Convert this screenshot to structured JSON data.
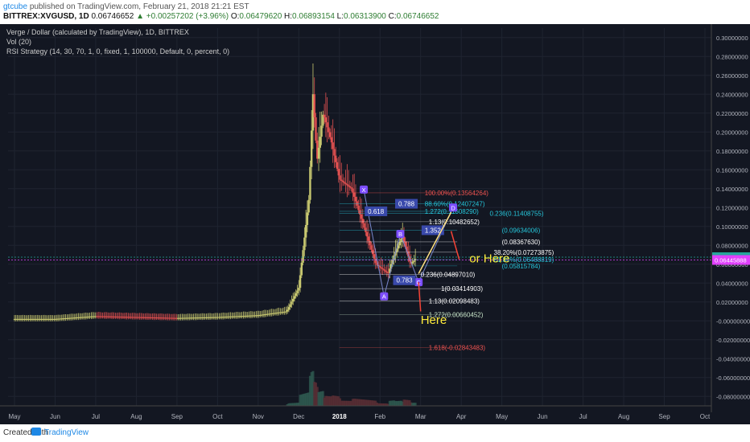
{
  "header": {
    "user": "gtcube",
    "published": "published on TradingView.com, February 21, 2018 21:21 EST",
    "symbol": "BITTREX:XVGUSD, 1D",
    "last": "0.06746652",
    "change": "▲ +0.00257202 (+3.96%)",
    "o_label": "O:",
    "o_val": "0.06479620",
    "h_label": "H:",
    "h_val": "0.06893154",
    "l_label": "L:",
    "l_val": "0.06313900",
    "c_label": "C:",
    "c_val": "0.06746652"
  },
  "legend": {
    "line1": "Verge / Dollar (calculated by TradingView), 1D, BITTREX",
    "line2": "Vol (20)",
    "line3": "RSI Strategy (14, 30, 70, 1, 0, fixed, 1, 100000, Default, 0, percent, 0)"
  },
  "footer": {
    "created": "Created with",
    "brand": "TradingView"
  },
  "colors": {
    "bg": "#131722",
    "up": "#c8c870",
    "down": "#e05050",
    "grid": "#1f2430",
    "axis_text": "#b2b5be"
  },
  "chart_data": {
    "type": "line",
    "title": "Verge / Dollar (calculated by TradingView), 1D, BITTREX",
    "x_ticks": [
      "May",
      "Jun",
      "Jul",
      "Aug",
      "Sep",
      "Oct",
      "Nov",
      "Dec",
      "2018",
      "Feb",
      "Mar",
      "Apr",
      "May",
      "Jun",
      "Jul",
      "Aug",
      "Sep",
      "Oct"
    ],
    "y_ticks": [
      "0.30000000",
      "0.28000000",
      "0.26000000",
      "0.24000000",
      "0.22000000",
      "0.20000000",
      "0.18000000",
      "0.16000000",
      "0.14000000",
      "0.12000000",
      "0.10000000",
      "0.08000000",
      "0.06000000",
      "0.04000000",
      "0.02000000",
      "-0.00000000",
      "-0.02000000",
      "-0.04000000",
      "-0.06000000",
      "-0.08000000"
    ],
    "ylim": [
      -0.09,
      0.31
    ],
    "price_tags": [
      {
        "text": "0.06746652",
        "value": 0.06746652,
        "color": "#26a69a"
      },
      {
        "text": "0.06445888",
        "value": 0.06445888,
        "color": "#e040fb"
      }
    ],
    "price_series": [
      {
        "m": 0,
        "v": 0.002
      },
      {
        "m": 1,
        "v": 0.002
      },
      {
        "m": 2,
        "v": 0.005
      },
      {
        "m": 3,
        "v": 0.004
      },
      {
        "m": 4,
        "v": 0.003
      },
      {
        "m": 5,
        "v": 0.004
      },
      {
        "m": 6,
        "v": 0.006
      },
      {
        "m": 6.7,
        "v": 0.01
      },
      {
        "m": 7.0,
        "v": 0.035
      },
      {
        "m": 7.25,
        "v": 0.13
      },
      {
        "m": 7.35,
        "v": 0.24
      },
      {
        "m": 7.45,
        "v": 0.17
      },
      {
        "m": 7.6,
        "v": 0.22
      },
      {
        "m": 7.8,
        "v": 0.19
      },
      {
        "m": 8.0,
        "v": 0.15
      },
      {
        "m": 8.3,
        "v": 0.14
      },
      {
        "m": 8.6,
        "v": 0.1
      },
      {
        "m": 8.9,
        "v": 0.06
      },
      {
        "m": 9.2,
        "v": 0.05
      },
      {
        "m": 9.35,
        "v": 0.07
      },
      {
        "m": 9.55,
        "v": 0.09
      },
      {
        "m": 9.75,
        "v": 0.06
      },
      {
        "m": 9.9,
        "v": 0.067
      }
    ],
    "fib_labels": [
      {
        "text": "100.00%(0.13564264)",
        "y": 0.1356,
        "color": "#ef5350",
        "m": 10.1
      },
      {
        "text": "88.60%(0.12407247)",
        "y": 0.124,
        "color": "#26c6da",
        "m": 10.1
      },
      {
        "text": "1.272(0.11608290)",
        "y": 0.116,
        "color": "#26c6da",
        "m": 10.1
      },
      {
        "text": "0.236(0.11408755)",
        "y": 0.114,
        "color": "#26c6da",
        "m": 11.7
      },
      {
        "text": "1.13(0.10482652)",
        "y": 0.105,
        "color": "#ffffff",
        "m": 10.2
      },
      {
        "text": "(0.09634006)",
        "y": 0.096,
        "color": "#26c6da",
        "m": 12.0
      },
      {
        "text": "(0.08367630)",
        "y": 0.0837,
        "color": "#ffffff",
        "m": 12.0
      },
      {
        "text": "38.20%(0.07273875)",
        "y": 0.0727,
        "color": "#ffffff",
        "m": 11.8
      },
      {
        "text": "61.80%(0.06488819)",
        "y": 0.0649,
        "color": "#26c6da",
        "m": 11.8
      },
      {
        "text": "(0.05815784)",
        "y": 0.0582,
        "color": "#26c6da",
        "m": 12.0
      },
      {
        "text": "0.236(0.04897010)",
        "y": 0.049,
        "color": "#ffffff",
        "m": 10.0
      },
      {
        "text": "1(0.03414903)",
        "y": 0.0341,
        "color": "#ffffff",
        "m": 10.5
      },
      {
        "text": "1.13(0.02098483)",
        "y": 0.021,
        "color": "#ffffff",
        "m": 10.2
      },
      {
        "text": "1.272(0.00660452)",
        "y": 0.0066,
        "color": "#c8e6c9",
        "m": 10.2
      },
      {
        "text": "1.618(-0.02843483)",
        "y": -0.0284,
        "color": "#ef5350",
        "m": 10.2
      }
    ],
    "pattern_points": [
      {
        "label": "X",
        "m": 8.6,
        "v": 0.139
      },
      {
        "label": "A",
        "m": 9.1,
        "v": 0.026
      },
      {
        "label": "B",
        "m": 9.5,
        "v": 0.092
      },
      {
        "label": "C",
        "m": 9.95,
        "v": 0.041
      },
      {
        "label": "D",
        "m": 10.8,
        "v": 0.12
      }
    ],
    "ratio_labels": [
      {
        "text": "0.618",
        "m": 8.9,
        "v": 0.116
      },
      {
        "text": "0.788",
        "m": 9.65,
        "v": 0.124
      },
      {
        "text": "1.352",
        "m": 10.3,
        "v": 0.096
      },
      {
        "text": "0.783",
        "m": 9.6,
        "v": 0.043
      }
    ],
    "annotations": [
      {
        "text": "Here",
        "m": 10.0,
        "v": -0.003,
        "color": "#ffeb3b"
      },
      {
        "text": "or Here",
        "m": 11.2,
        "v": 0.062,
        "color": "#ffeb3b"
      }
    ]
  }
}
